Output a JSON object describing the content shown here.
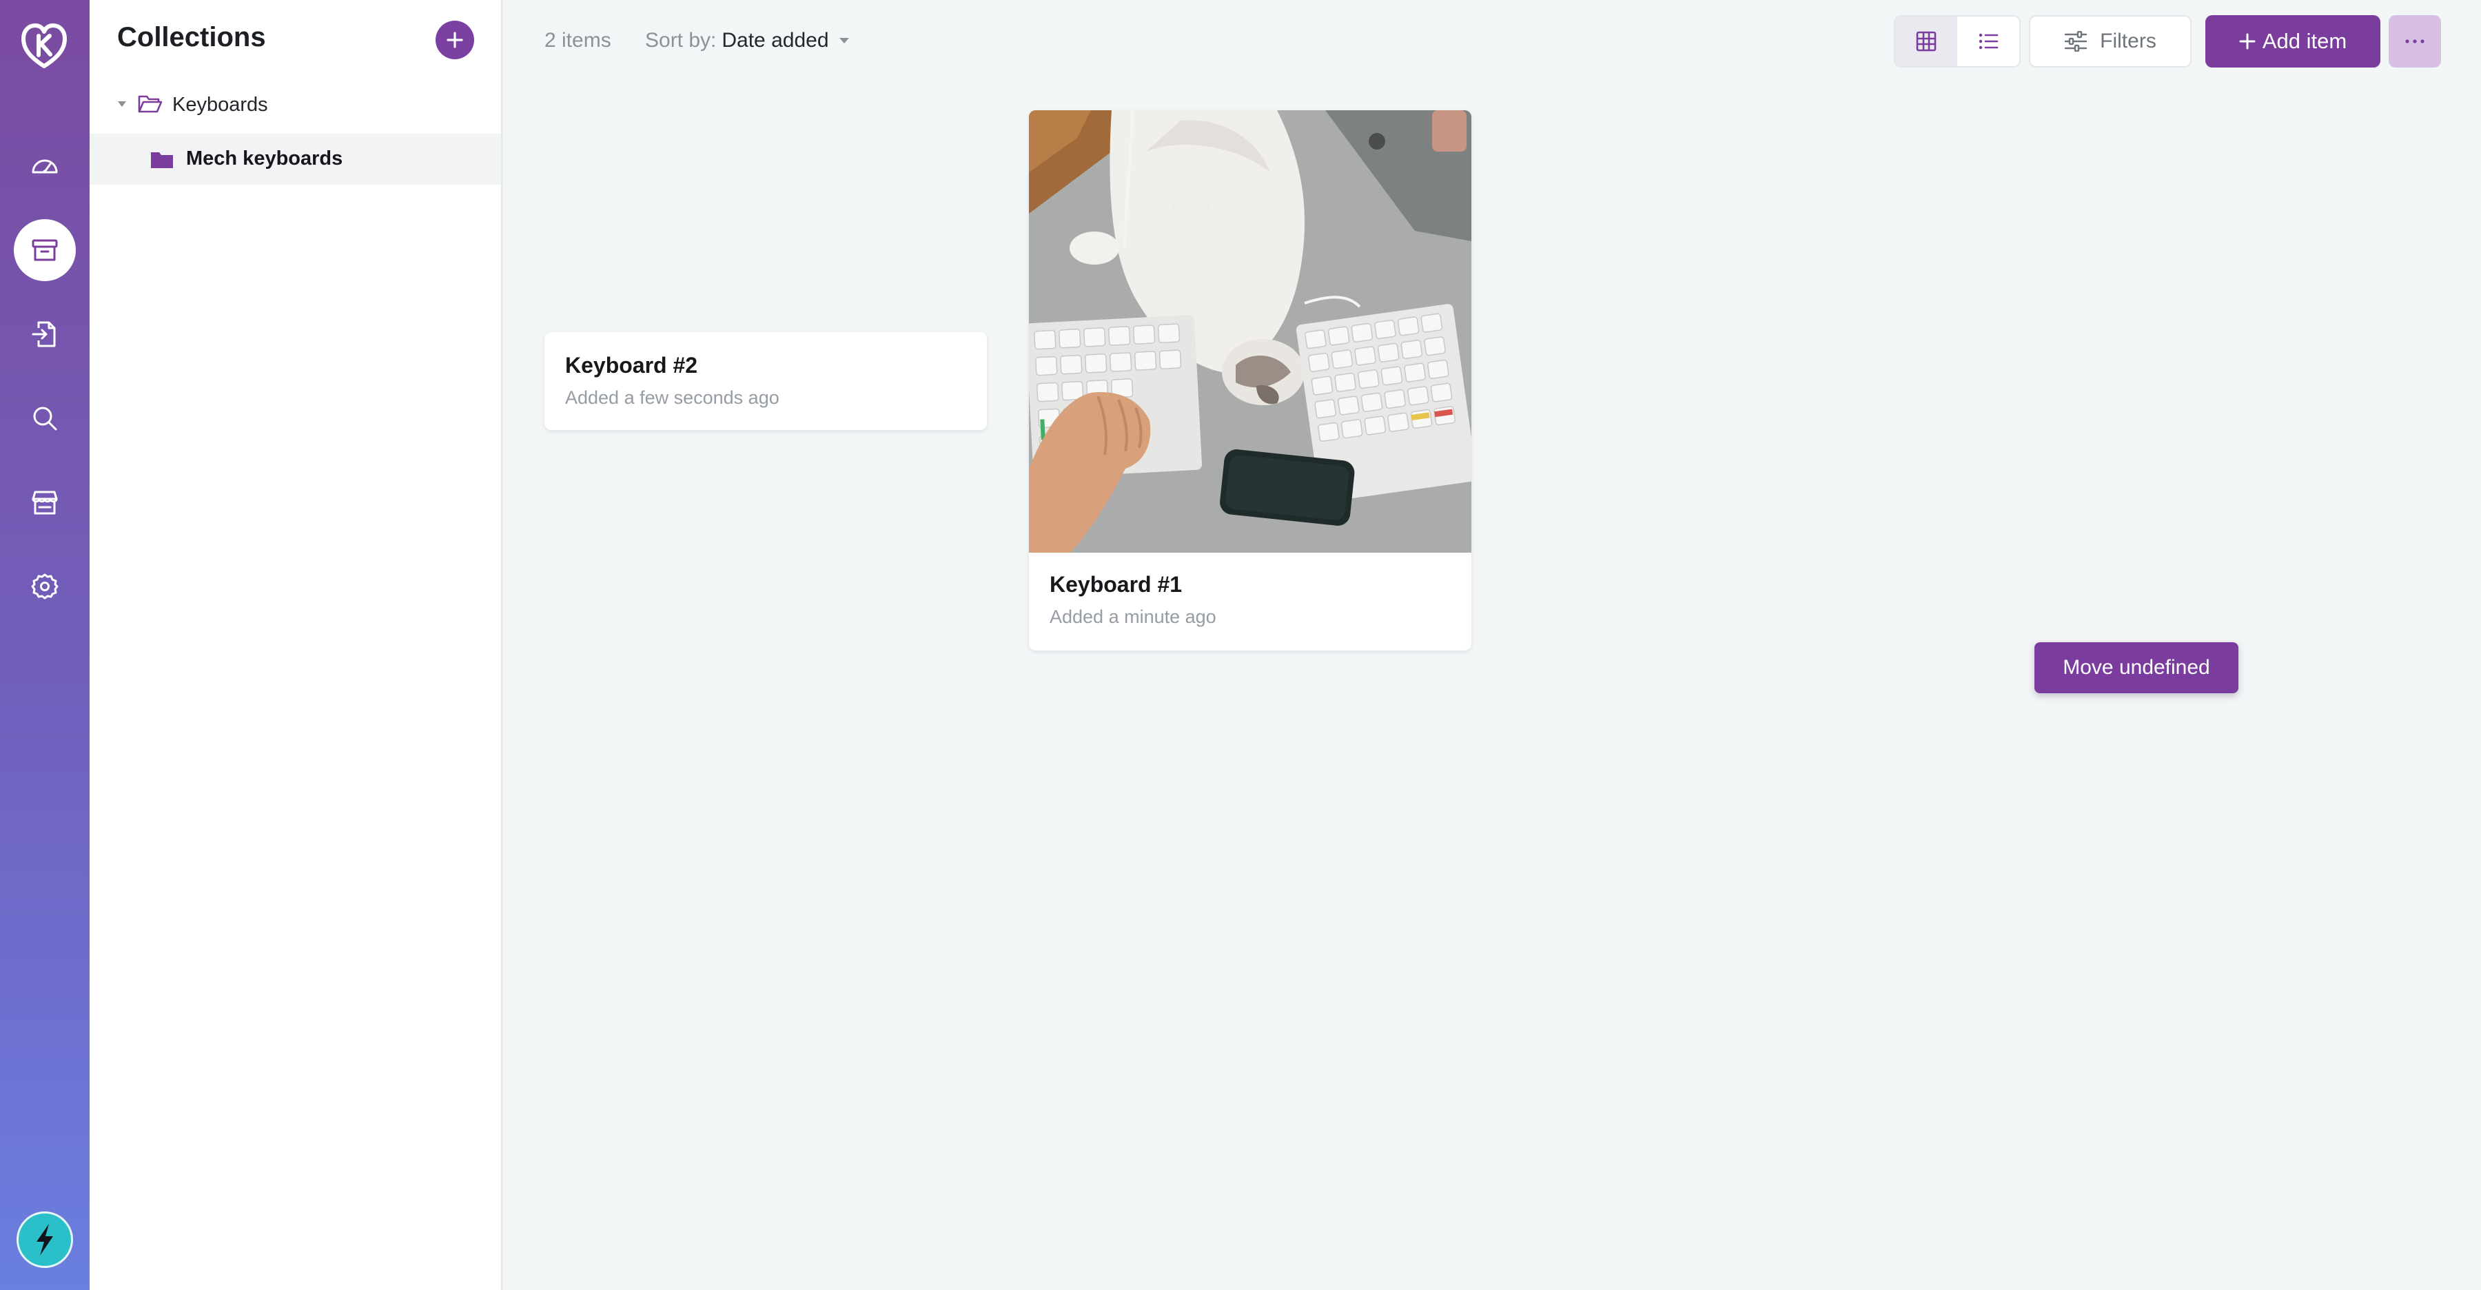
{
  "rail": {
    "nav": [
      "dashboard-icon",
      "inventory-icon",
      "import-icon",
      "search-icon",
      "store-icon",
      "settings-icon"
    ],
    "active": "inventory-icon",
    "gradient": [
      "#7a4ba0",
      "#6a7fe0"
    ]
  },
  "sidebar": {
    "title": "Collections",
    "tree": [
      {
        "label": "Keyboards",
        "expanded": true
      },
      {
        "label": "Mech keyboards",
        "selected": true
      }
    ]
  },
  "toolbar": {
    "item_count": "2 items",
    "sort_prefix": "Sort by:",
    "sort_value": "Date added",
    "view_modes": [
      "grid",
      "list"
    ],
    "active_view": "grid",
    "filters_label": "Filters",
    "add_item_label": "Add item"
  },
  "items": [
    {
      "name": "Keyboard #2",
      "added": "Added a few seconds ago",
      "has_image": false
    },
    {
      "name": "Keyboard #1",
      "added": "Added a minute ago",
      "has_image": true
    }
  ],
  "move_button_label": "Move undefined",
  "colors": {
    "accent": "#7a3d9d",
    "accent_light": "#d6bfe2",
    "background": "#f3f6f7"
  }
}
